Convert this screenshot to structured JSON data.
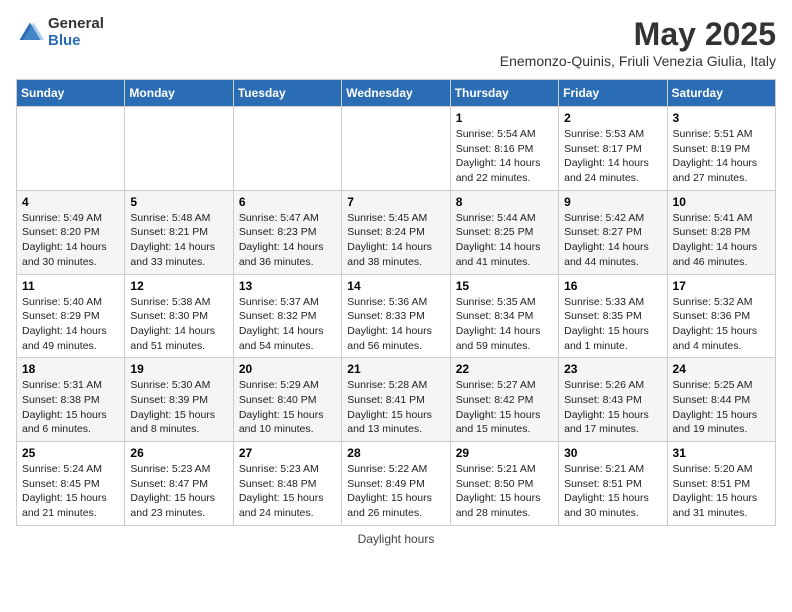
{
  "header": {
    "logo_general": "General",
    "logo_blue": "Blue",
    "month_year": "May 2025",
    "subtitle": "Enemonzo-Quinis, Friuli Venezia Giulia, Italy"
  },
  "weekdays": [
    "Sunday",
    "Monday",
    "Tuesday",
    "Wednesday",
    "Thursday",
    "Friday",
    "Saturday"
  ],
  "footer": "Daylight hours",
  "weeks": [
    [
      {
        "day": "",
        "data": ""
      },
      {
        "day": "",
        "data": ""
      },
      {
        "day": "",
        "data": ""
      },
      {
        "day": "",
        "data": ""
      },
      {
        "day": "1",
        "data": "Sunrise: 5:54 AM\nSunset: 8:16 PM\nDaylight: 14 hours\nand 22 minutes."
      },
      {
        "day": "2",
        "data": "Sunrise: 5:53 AM\nSunset: 8:17 PM\nDaylight: 14 hours\nand 24 minutes."
      },
      {
        "day": "3",
        "data": "Sunrise: 5:51 AM\nSunset: 8:19 PM\nDaylight: 14 hours\nand 27 minutes."
      }
    ],
    [
      {
        "day": "4",
        "data": "Sunrise: 5:49 AM\nSunset: 8:20 PM\nDaylight: 14 hours\nand 30 minutes."
      },
      {
        "day": "5",
        "data": "Sunrise: 5:48 AM\nSunset: 8:21 PM\nDaylight: 14 hours\nand 33 minutes."
      },
      {
        "day": "6",
        "data": "Sunrise: 5:47 AM\nSunset: 8:23 PM\nDaylight: 14 hours\nand 36 minutes."
      },
      {
        "day": "7",
        "data": "Sunrise: 5:45 AM\nSunset: 8:24 PM\nDaylight: 14 hours\nand 38 minutes."
      },
      {
        "day": "8",
        "data": "Sunrise: 5:44 AM\nSunset: 8:25 PM\nDaylight: 14 hours\nand 41 minutes."
      },
      {
        "day": "9",
        "data": "Sunrise: 5:42 AM\nSunset: 8:27 PM\nDaylight: 14 hours\nand 44 minutes."
      },
      {
        "day": "10",
        "data": "Sunrise: 5:41 AM\nSunset: 8:28 PM\nDaylight: 14 hours\nand 46 minutes."
      }
    ],
    [
      {
        "day": "11",
        "data": "Sunrise: 5:40 AM\nSunset: 8:29 PM\nDaylight: 14 hours\nand 49 minutes."
      },
      {
        "day": "12",
        "data": "Sunrise: 5:38 AM\nSunset: 8:30 PM\nDaylight: 14 hours\nand 51 minutes."
      },
      {
        "day": "13",
        "data": "Sunrise: 5:37 AM\nSunset: 8:32 PM\nDaylight: 14 hours\nand 54 minutes."
      },
      {
        "day": "14",
        "data": "Sunrise: 5:36 AM\nSunset: 8:33 PM\nDaylight: 14 hours\nand 56 minutes."
      },
      {
        "day": "15",
        "data": "Sunrise: 5:35 AM\nSunset: 8:34 PM\nDaylight: 14 hours\nand 59 minutes."
      },
      {
        "day": "16",
        "data": "Sunrise: 5:33 AM\nSunset: 8:35 PM\nDaylight: 15 hours\nand 1 minute."
      },
      {
        "day": "17",
        "data": "Sunrise: 5:32 AM\nSunset: 8:36 PM\nDaylight: 15 hours\nand 4 minutes."
      }
    ],
    [
      {
        "day": "18",
        "data": "Sunrise: 5:31 AM\nSunset: 8:38 PM\nDaylight: 15 hours\nand 6 minutes."
      },
      {
        "day": "19",
        "data": "Sunrise: 5:30 AM\nSunset: 8:39 PM\nDaylight: 15 hours\nand 8 minutes."
      },
      {
        "day": "20",
        "data": "Sunrise: 5:29 AM\nSunset: 8:40 PM\nDaylight: 15 hours\nand 10 minutes."
      },
      {
        "day": "21",
        "data": "Sunrise: 5:28 AM\nSunset: 8:41 PM\nDaylight: 15 hours\nand 13 minutes."
      },
      {
        "day": "22",
        "data": "Sunrise: 5:27 AM\nSunset: 8:42 PM\nDaylight: 15 hours\nand 15 minutes."
      },
      {
        "day": "23",
        "data": "Sunrise: 5:26 AM\nSunset: 8:43 PM\nDaylight: 15 hours\nand 17 minutes."
      },
      {
        "day": "24",
        "data": "Sunrise: 5:25 AM\nSunset: 8:44 PM\nDaylight: 15 hours\nand 19 minutes."
      }
    ],
    [
      {
        "day": "25",
        "data": "Sunrise: 5:24 AM\nSunset: 8:45 PM\nDaylight: 15 hours\nand 21 minutes."
      },
      {
        "day": "26",
        "data": "Sunrise: 5:23 AM\nSunset: 8:47 PM\nDaylight: 15 hours\nand 23 minutes."
      },
      {
        "day": "27",
        "data": "Sunrise: 5:23 AM\nSunset: 8:48 PM\nDaylight: 15 hours\nand 24 minutes."
      },
      {
        "day": "28",
        "data": "Sunrise: 5:22 AM\nSunset: 8:49 PM\nDaylight: 15 hours\nand 26 minutes."
      },
      {
        "day": "29",
        "data": "Sunrise: 5:21 AM\nSunset: 8:50 PM\nDaylight: 15 hours\nand 28 minutes."
      },
      {
        "day": "30",
        "data": "Sunrise: 5:21 AM\nSunset: 8:51 PM\nDaylight: 15 hours\nand 30 minutes."
      },
      {
        "day": "31",
        "data": "Sunrise: 5:20 AM\nSunset: 8:51 PM\nDaylight: 15 hours\nand 31 minutes."
      }
    ]
  ]
}
